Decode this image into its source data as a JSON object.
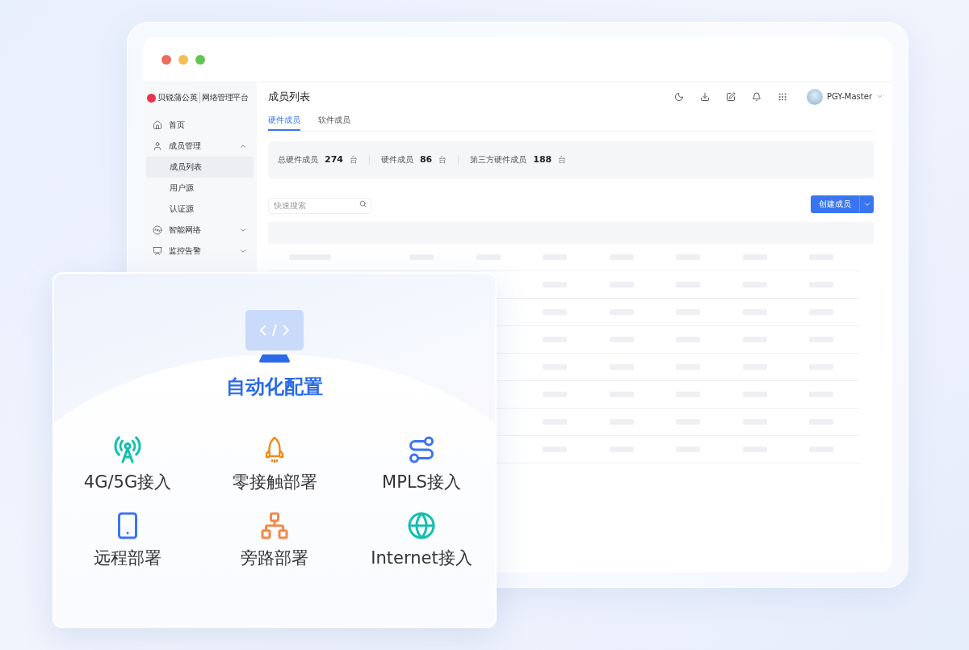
{
  "sidebar": {
    "brand": "贝锐蒲公英",
    "platform": "网络管理平台",
    "items": [
      {
        "kind": "link",
        "label": "首页"
      },
      {
        "kind": "group",
        "label": "成员管理",
        "expanded": true,
        "children": [
          {
            "label": "成员列表",
            "selected": true
          },
          {
            "label": "用户源",
            "selected": false
          },
          {
            "label": "认证源",
            "selected": false
          }
        ]
      },
      {
        "kind": "group",
        "label": "智能网络",
        "expanded": false
      },
      {
        "kind": "group",
        "label": "监控告警",
        "expanded": false
      }
    ]
  },
  "header": {
    "title": "成员列表",
    "user": "PGY-Master"
  },
  "tabs": [
    {
      "label": "硬件成员",
      "selected": true
    },
    {
      "label": "软件成员",
      "selected": false
    }
  ],
  "stats": [
    {
      "label": "总硬件成员",
      "value": "274",
      "unit": "台"
    },
    {
      "label": "硬件成员",
      "value": "86",
      "unit": "台"
    },
    {
      "label": "第三方硬件成员",
      "value": "188",
      "unit": "台"
    }
  ],
  "search": {
    "placeholder": "快速搜索"
  },
  "create_button": "创建成员",
  "feature_card": {
    "title": "自动化配置",
    "features": [
      {
        "kind": "antenna",
        "label": "4G/5G接入"
      },
      {
        "kind": "rocket",
        "label": "零接触部署"
      },
      {
        "kind": "route",
        "label": "MPLS接入"
      },
      {
        "kind": "phone",
        "label": "远程部署"
      },
      {
        "kind": "network",
        "label": "旁路部署"
      },
      {
        "kind": "globe",
        "label": "Internet接入"
      }
    ]
  }
}
